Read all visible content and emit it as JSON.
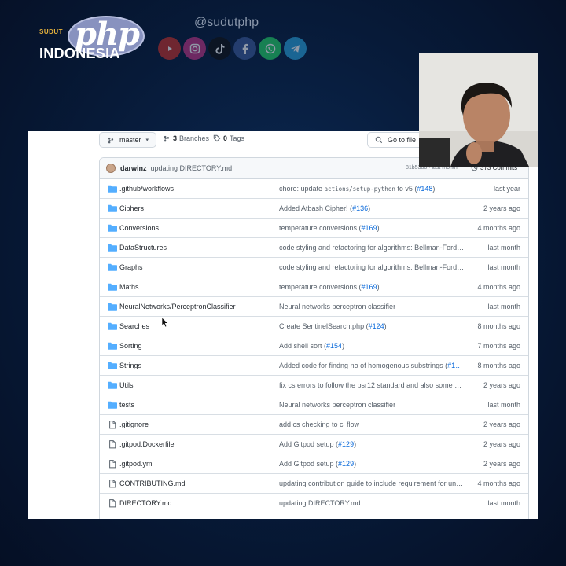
{
  "brand": {
    "small_text": "SUDUT",
    "logo_text": "php",
    "title": "INDONESIA",
    "handle": "@sudutphp"
  },
  "socials": [
    {
      "icon": "youtube-icon",
      "color": "#c4302b"
    },
    {
      "icon": "instagram-icon",
      "color": "#c13584"
    },
    {
      "icon": "tiktok-icon",
      "color": "#111111"
    },
    {
      "icon": "facebook-icon",
      "color": "#3b5998"
    },
    {
      "icon": "whatsapp-icon",
      "color": "#25d366"
    },
    {
      "icon": "telegram-icon",
      "color": "#2aa1da"
    }
  ],
  "repo": {
    "branch": "master",
    "branches_count": "3",
    "branches_label": "Branches",
    "tags_count": "0",
    "tags_label": "Tags",
    "goto_label": "Go to file",
    "last_commit": {
      "author": "darwinz",
      "message": "updating DIRECTORY.md",
      "hash_and_time": "81b5386 · last month",
      "commits": "373 Commits"
    },
    "rows": [
      {
        "type": "folder",
        "name": ".github/workflows",
        "msg": "chore: update ",
        "code": "actions/setup-python",
        "msg2": " to v5 (",
        "link": "#148",
        "msg3": ")",
        "date": "last year"
      },
      {
        "type": "folder",
        "name": "Ciphers",
        "msg": "Added Atbash Cipher! (",
        "code": "",
        "msg2": "",
        "link": "#136",
        "msg3": ")",
        "date": "2 years ago"
      },
      {
        "type": "folder",
        "name": "Conversions",
        "msg": "temperature conversions (",
        "code": "",
        "msg2": "",
        "link": "#169",
        "msg3": ")",
        "date": "4 months ago"
      },
      {
        "type": "folder",
        "name": "DataStructures",
        "msg": "code styling and refactoring for algorithms: Bellman-Ford…",
        "code": "",
        "msg2": "",
        "link": "",
        "msg3": "",
        "date": "last month"
      },
      {
        "type": "folder",
        "name": "Graphs",
        "msg": "code styling and refactoring for algorithms: Bellman-Ford…",
        "code": "",
        "msg2": "",
        "link": "",
        "msg3": "",
        "date": "last month"
      },
      {
        "type": "folder",
        "name": "Maths",
        "msg": "temperature conversions (",
        "code": "",
        "msg2": "",
        "link": "#169",
        "msg3": ")",
        "date": "4 months ago"
      },
      {
        "type": "folder",
        "name": "NeuralNetworks/PerceptronClassifier",
        "msg": "Neural networks perceptron classifier",
        "code": "",
        "msg2": "",
        "link": "",
        "msg3": "",
        "date": "last month"
      },
      {
        "type": "folder",
        "name": "Searches",
        "msg": "Create SentinelSearch.php (",
        "code": "",
        "msg2": "",
        "link": "#124",
        "msg3": ")",
        "date": "8 months ago"
      },
      {
        "type": "folder",
        "name": "Sorting",
        "msg": "Add shell sort (",
        "code": "",
        "msg2": "",
        "link": "#154",
        "msg3": ")",
        "date": "7 months ago"
      },
      {
        "type": "folder",
        "name": "Strings",
        "msg": "Added code for findng no of homogenous substrings (",
        "code": "",
        "msg2": "",
        "link": "#1…",
        "msg3": "",
        "date": "8 months ago"
      },
      {
        "type": "folder",
        "name": "Utils",
        "msg": "fix cs errors to follow the psr12 standard and also some m…",
        "code": "",
        "msg2": "",
        "link": "",
        "msg3": "",
        "date": "2 years ago"
      },
      {
        "type": "folder",
        "name": "tests",
        "msg": "Neural networks perceptron classifier",
        "code": "",
        "msg2": "",
        "link": "",
        "msg3": "",
        "date": "last month"
      },
      {
        "type": "file",
        "name": ".gitignore",
        "msg": "add cs checking to ci flow",
        "code": "",
        "msg2": "",
        "link": "",
        "msg3": "",
        "date": "2 years ago"
      },
      {
        "type": "file",
        "name": ".gitpod.Dockerfile",
        "msg": "Add Gitpod setup (",
        "code": "",
        "msg2": "",
        "link": "#129",
        "msg3": ")",
        "date": "2 years ago"
      },
      {
        "type": "file",
        "name": ".gitpod.yml",
        "msg": "Add Gitpod setup (",
        "code": "",
        "msg2": "",
        "link": "#129",
        "msg3": ")",
        "date": "2 years ago"
      },
      {
        "type": "file",
        "name": "CONTRIBUTING.md",
        "msg": "updating contribution guide to include requirement for uni…",
        "code": "",
        "msg2": "",
        "link": "",
        "msg3": "",
        "date": "4 months ago"
      },
      {
        "type": "file",
        "name": "DIRECTORY.md",
        "msg": "updating DIRECTORY.md",
        "code": "",
        "msg2": "",
        "link": "",
        "msg3": "",
        "date": "last month"
      }
    ]
  },
  "colors": {
    "folder": "#54aeff",
    "file": "#57606a",
    "link": "#0969da",
    "background": "#071a38"
  }
}
